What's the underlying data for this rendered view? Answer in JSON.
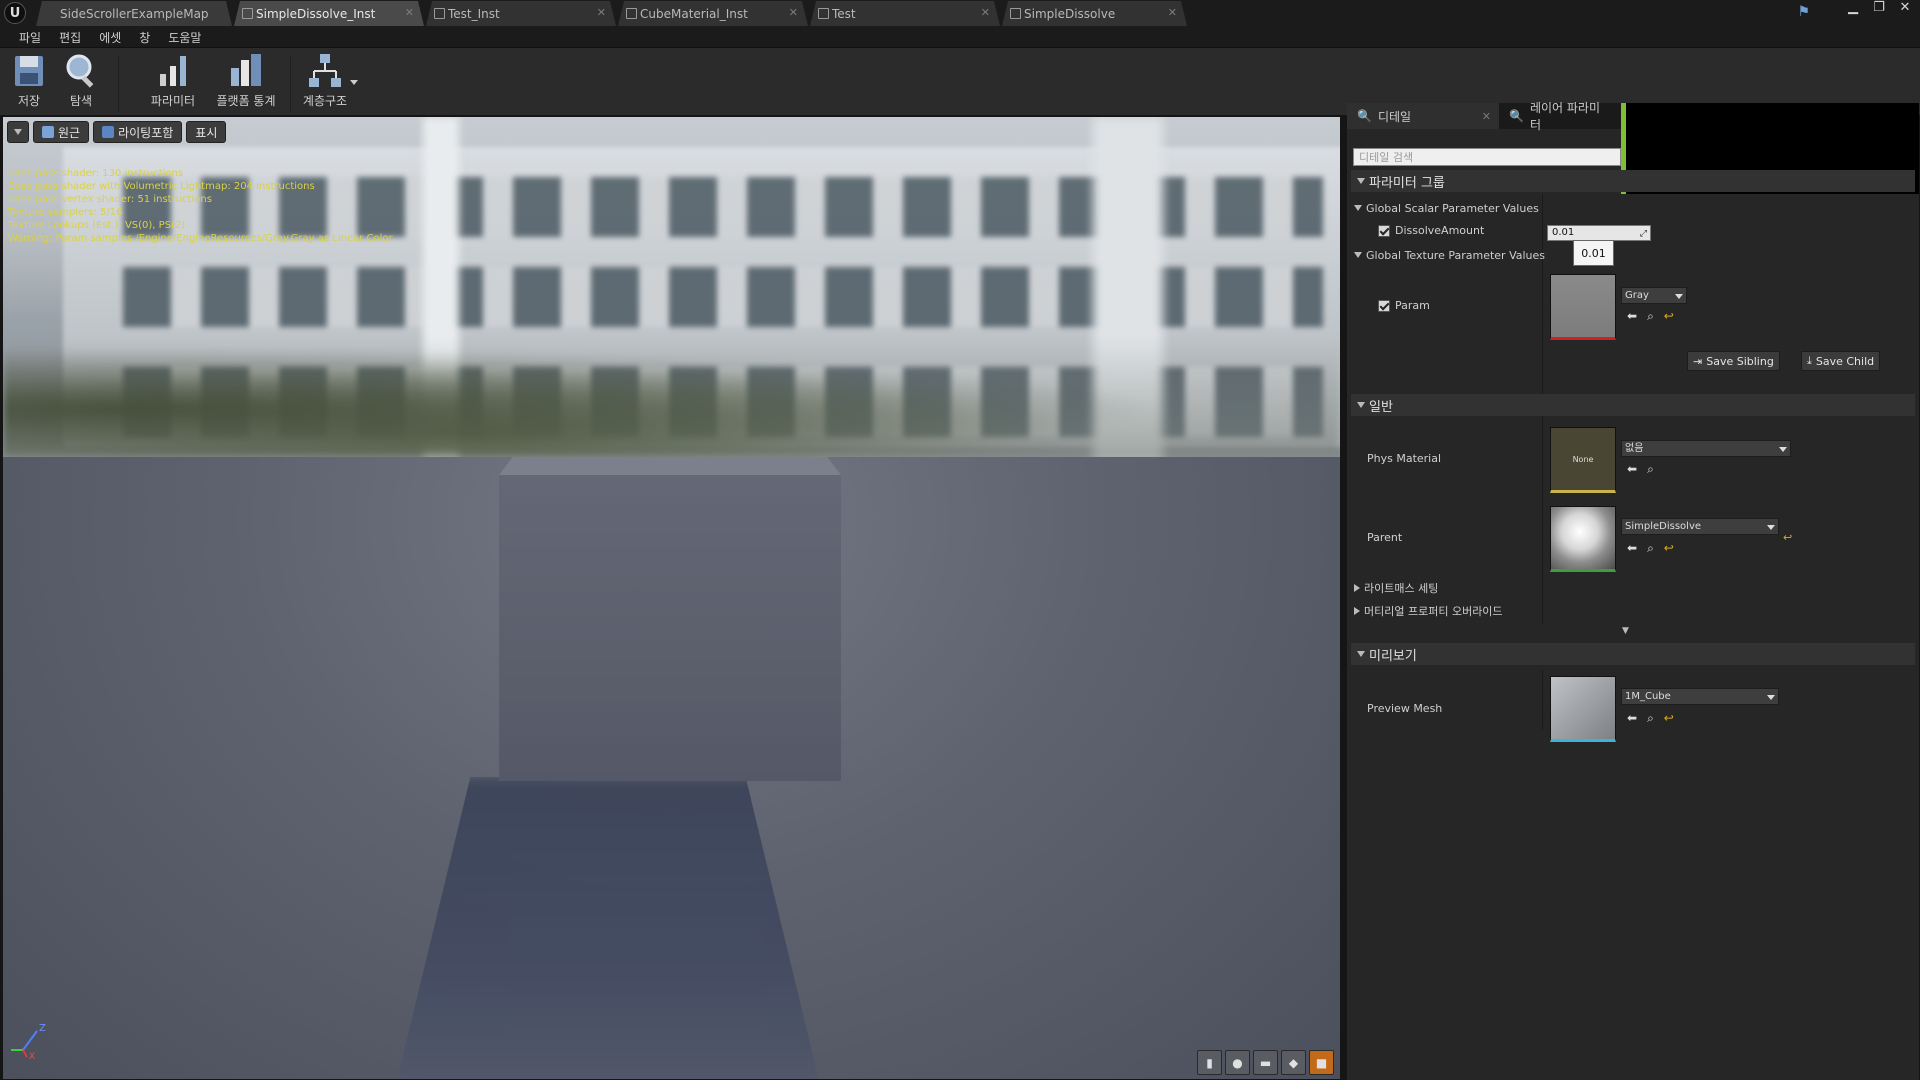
{
  "window": {
    "tabs": [
      {
        "label": "SideScrollerExampleMap",
        "active": false
      },
      {
        "label": "SimpleDissolve_Inst",
        "active": true
      },
      {
        "label": "Test_Inst",
        "active": false
      },
      {
        "label": "CubeMaterial_Inst",
        "active": false
      },
      {
        "label": "Test",
        "active": false
      },
      {
        "label": "SimpleDissolve",
        "active": false
      }
    ]
  },
  "menu": [
    "파일",
    "편집",
    "에셋",
    "창",
    "도움말"
  ],
  "toolbar": {
    "save": "저장",
    "browse": "탐색",
    "params": "파라미터",
    "platform_stats": "플랫폼 통계",
    "hierarchy": "계층구조"
  },
  "viewport": {
    "view_mode_label": "원근",
    "lighting_label": "라이팅포함",
    "show_label": "표시",
    "shader_stats": [
      "Base pass shader: 130 instructions",
      "Base pass shader with Volumetric Lightmap: 204 instructions",
      "Base pass vertex shader: 51 instructions",
      "Texture samplers: 5/16",
      "Texture Lookups (Est.): VS(0), PS(2)",
      "Warning: Param samples /Engine/EngineResources/Gray.Gray as Linear Color."
    ],
    "axis": {
      "z": "Z",
      "y": "Y",
      "x": "X"
    }
  },
  "details": {
    "tab_details": "디테일",
    "tab_layer": "레이어 파라미터",
    "search_placeholder": "디테일 검색",
    "param_groups": "파라미터 그룹",
    "global_scalar": "Global Scalar Parameter Values",
    "dissolve_label": "DissolveAmount",
    "dissolve_value": "0.01",
    "dissolve_tooltip": "0.01",
    "global_texture": "Global Texture Parameter Values",
    "param_label": "Param",
    "param_texture": "Gray",
    "save_sibling": "Save Sibling",
    "save_child": "Save Child",
    "general": "일반",
    "phys_material_label": "Phys Material",
    "phys_material_thumb": "None",
    "phys_material_value": "없음",
    "parent_label": "Parent",
    "parent_value": "SimpleDissolve",
    "lightmass": "라이트매스 세팅",
    "material_override": "머티리얼 프로퍼티 오버라이드",
    "preview": "미리보기",
    "preview_mesh_label": "Preview Mesh",
    "preview_mesh_value": "1M_Cube"
  },
  "colors": {
    "accent_green": "#7fbf36",
    "active_preview_button": "#c36a1a",
    "shader_text": "#d9d246",
    "reset_arrow": "#d8a826"
  }
}
